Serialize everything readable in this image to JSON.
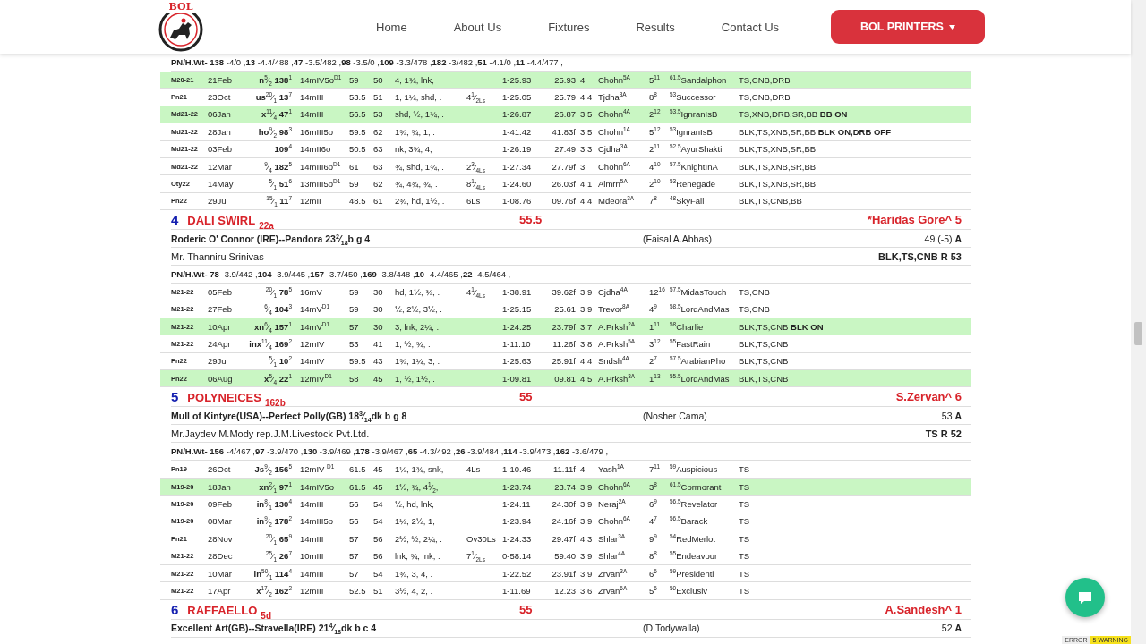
{
  "header": {
    "logo_text": "BOL",
    "nav": [
      "Home",
      "About Us",
      "Fixtures",
      "Results",
      "Contact Us"
    ],
    "button": "BOL PRINTERS"
  },
  "horses": [
    {
      "past_runs": "**PN/H.Wt- 138** -4/0 ,**13** -4.4/488 ,**47** -3.5/482 ,**98** -3.5/0 ,**109** -3.3/478 ,**182** -3/482 ,**51** -4.1/0 ,**11** -4.4/477 ,",
      "rows": [
        {
          "highlighted": true,
          "race": "M20-21",
          "date": "21Feb",
          "odds": "**n**$^{5}$⁄$_{2}$ **138**$^{1}$",
          "distance": "14mIV5o$^{D1}$",
          "weight": "59",
          "rating": "50",
          "margins": "4, 1¾, lnk,",
          "time": "1-25.93",
          "sectional": "25.93",
          "pace": "4",
          "jockey": "Chohn$^{5A}$",
          "placing": "5$^{11}$",
          "winner": "$^{61.5}$Sandalphon",
          "gear": "TS,CNB,DRB"
        },
        {
          "highlighted": false,
          "race": "Pn21",
          "date": "23Oct",
          "odds": "**us**$^{20}$⁄$_{1}$ **13**$^{7}$",
          "distance": "14mIII",
          "weight": "53.5",
          "rating": "51",
          "margins": "1, 1¼, shd, .",
          "beaten": "4$^{1}$⁄$_{2Ls}$",
          "time": "1-25.05",
          "sectional": "25.79",
          "pace": "4.4",
          "jockey": "Tjdha$^{3A}$",
          "placing": "8$^{8}$",
          "winner": "$^{53}$Successor",
          "gear": "TS,CNB,DRB"
        },
        {
          "highlighted": true,
          "race": "Md21-22",
          "date": "06Jan",
          "odds": "**x**$^{11}$⁄$_{4}$ **47**$^{1}$",
          "distance": "14mIII",
          "weight": "56.5",
          "rating": "53",
          "margins": "shd, ½, 1¾, .",
          "time": "1-26.87",
          "sectional": "26.87",
          "pace": "3.5",
          "jockey": "Chohn$^{4A}$",
          "placing": "2$^{12}$",
          "winner": "$^{53.5}$IgnranIsB",
          "gear": "TS,XNB,DRB,SR,BB **BB ON**"
        },
        {
          "highlighted": false,
          "race": "Md21-22",
          "date": "28Jan",
          "odds": "**ho**$^{9}$⁄$_{2}$ **98**$^{3}$",
          "distance": "16mIII5o",
          "weight": "59.5",
          "rating": "62",
          "margins": "1¾, ¾, 1, .",
          "time": "1-41.42",
          "sectional": "41.83f",
          "pace": "3.5",
          "jockey": "Chohn$^{1A}$",
          "placing": "5$^{12}$",
          "winner": "$^{53}$IgnranIsB",
          "gear": "BLK,TS,XNB,SR,BB **BLK ON,DRB OFF**"
        },
        {
          "highlighted": false,
          "race": "Md21-22",
          "date": "03Feb",
          "odds": "**109**$^{4}$",
          "distance": "14mII6o",
          "weight": "50.5",
          "rating": "63",
          "margins": "nk, 3¾, 4,",
          "time": "1-26.19",
          "sectional": "27.49",
          "pace": "3.3",
          "jockey": "Cjdha$^{3A}$",
          "placing": "2$^{11}$",
          "winner": "$^{52.5}$AyurShakti",
          "gear": "BLK,TS,XNB,SR,BB"
        },
        {
          "highlighted": false,
          "race": "Md21-22",
          "date": "12Mar",
          "odds": "$^{9}$⁄$_{4}$ **182**$^{5}$",
          "distance": "14mIII6o$^{D1}$",
          "weight": "61",
          "rating": "63",
          "margins": "¾, shd, 1¾, .",
          "beaten": "2$^{3}$⁄$_{4Ls}$",
          "time": "1-27.34",
          "sectional": "27.79f",
          "pace": "3",
          "jockey": "Chohn$^{6A}$",
          "placing": "4$^{10}$",
          "winner": "$^{57.5}$KnightInA",
          "gear": "BLK,TS,XNB,SR,BB"
        },
        {
          "highlighted": false,
          "race": "Oty22",
          "date": "14May",
          "odds": "$^{5}$⁄$_{1}$ **51**$^{6}$",
          "distance": "13mIII5o$^{D1}$",
          "weight": "59",
          "rating": "62",
          "margins": "¾, 4¾, ¾, .",
          "beaten": "8$^{1}$⁄$_{4Ls}$",
          "time": "1-24.60",
          "sectional": "26.03f",
          "pace": "4.1",
          "jockey": "Almrn$^{5A}$",
          "placing": "2$^{10}$",
          "winner": "$^{53}$Renegade",
          "gear": "BLK,TS,XNB,SR,BB"
        },
        {
          "highlighted": false,
          "race": "Pn22",
          "date": "29Jul",
          "odds": "$^{15}$⁄$_{1}$ **11**$^{7}$",
          "distance": "12mII",
          "weight": "48.5",
          "rating": "61",
          "margins": "2¾, hd, 1½, .",
          "beaten": "6Ls",
          "time": "1-08.76",
          "sectional": "09.76f",
          "pace": "4.4",
          "jockey": "Mdeora$^{3A}$",
          "placing": "7$^{8}$",
          "winner": "$^{48}$SkyFall",
          "gear": "BLK,TS,CNB,BB"
        }
      ]
    },
    {
      "number": "4",
      "name": "DALI SWIRL",
      "tag": "22a",
      "carried_weight": "55.5",
      "jockey": "*Haridas Gore^ 5",
      "pedigree": "Roderic O' Connor (IRE)--Pandora 23$^{2}$⁄$_{18}$b g 4",
      "trainer": "(Faisal A.Abbas)",
      "rating": "49 (-5) **A**",
      "owner": "Mr. Thanniru Srinivas",
      "gear": "BLK,TS,CNB R 53",
      "past_runs": "**PN/H.Wt- 78** -3.9/442 ,**104** -3.9/445 ,**157** -3.7/450 ,**169** -3.8/448 ,**10** -4.4/465 ,**22** -4.5/464 ,",
      "rows": [
        {
          "highlighted": false,
          "race": "M21-22",
          "date": "05Feb",
          "odds": "$^{20}$⁄$_{1}$ **78**$^{5}$",
          "distance": "16mV",
          "weight": "59",
          "rating": "30",
          "margins": "hd, 1½, ¾, .",
          "beaten": "4$^{1}$⁄$_{4Ls}$",
          "time": "1-38.91",
          "sectional": "39.62f",
          "pace": "3.9",
          "jockey": "Cjdha$^{4A}$",
          "placing": "12$^{16}$",
          "winner": "$^{57.5}$MidasTouch",
          "gear": "TS,CNB"
        },
        {
          "highlighted": false,
          "race": "M21-22",
          "date": "27Feb",
          "odds": "$^{6}$⁄$_{4}$ **104**$^{3}$",
          "distance": "14mV$^{D1}$",
          "weight": "59",
          "rating": "30",
          "margins": "½, 2½, 3½, .",
          "time": "1-25.15",
          "sectional": "25.61",
          "pace": "3.9",
          "jockey": "Trevor$^{8A}$",
          "placing": "4$^{9}$",
          "winner": "$^{58.5}$LordAndMas",
          "gear": "TS,CNB"
        },
        {
          "highlighted": true,
          "race": "M21-22",
          "date": "10Apr",
          "odds": "**xn**$^{6}$⁄$_{4}$ **157**$^{1}$",
          "distance": "14mV$^{D1}$",
          "weight": "57",
          "rating": "30",
          "margins": "3, lnk, 2¼, .",
          "time": "1-24.25",
          "sectional": "23.79f",
          "pace": "3.7",
          "jockey": "A.Prksh$^{2A}$",
          "placing": "1$^{11}$",
          "winner": "$^{58}$Charlie",
          "gear": "BLK,TS,CNB **BLK ON**"
        },
        {
          "highlighted": false,
          "race": "M21-22",
          "date": "24Apr",
          "odds": "**inx**$^{11}$⁄$_{4}$ **169**$^{2}$",
          "distance": "12mIV",
          "weight": "53",
          "rating": "41",
          "margins": "1, ½, ¾, .",
          "time": "1-11.10",
          "sectional": "11.26f",
          "pace": "3.8",
          "jockey": "A.Prksh$^{5A}$",
          "placing": "3$^{12}$",
          "winner": "$^{55}$FastRain",
          "gear": "BLK,TS,CNB"
        },
        {
          "highlighted": false,
          "race": "Pn22",
          "date": "29Jul",
          "odds": "$^{5}$⁄$_{1}$ **10**$^{2}$",
          "distance": "14mIV",
          "weight": "59.5",
          "rating": "43",
          "margins": "1¾, 1¼, 3, .",
          "time": "1-25.63",
          "sectional": "25.91f",
          "pace": "4.4",
          "jockey": "Sndsh$^{4A}$",
          "placing": "2$^{7}$",
          "winner": "$^{57.5}$ArabianPho",
          "gear": "BLK,TS,CNB"
        },
        {
          "highlighted": true,
          "race": "Pn22",
          "date": "06Aug",
          "odds": "**x**$^{5}$⁄$_{4}$ **22**$^{1}$",
          "distance": "12mIV$^{D1}$",
          "weight": "58",
          "rating": "45",
          "margins": "1, ½, 1½, .",
          "time": "1-09.81",
          "sectional": "09.81",
          "pace": "4.5",
          "jockey": "A.Prksh$^{3A}$",
          "placing": "1$^{13}$",
          "winner": "$^{55.5}$LordAndMas",
          "gear": "BLK,TS,CNB"
        }
      ]
    },
    {
      "number": "5",
      "name": "POLYNEICES",
      "tag": "162b",
      "carried_weight": "55",
      "jockey": "S.Zervan^ 6",
      "pedigree": "Mull of Kintyre(USA)--Perfect Polly(GB) 18$^{3}$⁄$_{14}$dk b g 8",
      "trainer": "(Nosher Cama)",
      "rating": "53 **A**",
      "owner": "Mr.Jaydev M.Mody rep.J.M.Livestock Pvt.Ltd.",
      "gear": "TS R 52",
      "past_runs": "**PN/H.Wt- 156** -4/467 ,**97** -3.9/470 ,**130** -3.9/469 ,**178** -3.9/467 ,**65** -4.3/492 ,**26** -3.9/484 ,**114** -3.9/473 ,**162** -3.6/479 ,",
      "rows": [
        {
          "highlighted": false,
          "race": "Pn19",
          "date": "26Oct",
          "odds": "**Js**$^{9}$⁄$_{2}$ **156**$^{5}$",
          "distance": "12mIV-$^{D1}$",
          "weight": "61.5",
          "rating": "45",
          "margins": "1¼, 1¾, snk,",
          "beaten": "4Ls",
          "time": "1-10.46",
          "sectional": "11.11f",
          "pace": "4",
          "jockey": "Yash$^{1A}$",
          "placing": "7$^{11}$",
          "winner": "$^{59}$Auspicious",
          "gear": "TS"
        },
        {
          "highlighted": true,
          "race": "M19-20",
          "date": "18Jan",
          "odds": "**xn**$^{2}$⁄$_{1}$ **97**$^{1}$",
          "distance": "14mIV5o",
          "weight": "61.5",
          "rating": "45",
          "margins": "1½, ¾, 4$^{1}$⁄$_{2}$,",
          "time": "1-23.74",
          "sectional": "23.74",
          "pace": "3.9",
          "jockey": "Chohn$^{6A}$",
          "placing": "3$^{8}$",
          "winner": "$^{61.5}$Cormorant",
          "gear": "TS"
        },
        {
          "highlighted": false,
          "race": "M19-20",
          "date": "09Feb",
          "odds": "**in**$^{8}$⁄$_{1}$ **130**$^{4}$",
          "distance": "14mIII",
          "weight": "56",
          "rating": "54",
          "margins": "½, hd, lnk,",
          "time": "1-24.11",
          "sectional": "24.30f",
          "pace": "3.9",
          "jockey": "Neraj$^{2A}$",
          "placing": "6$^{9}$",
          "winner": "$^{56.5}$Revelator",
          "gear": "TS"
        },
        {
          "highlighted": false,
          "race": "M19-20",
          "date": "08Mar",
          "odds": "**in**$^{9}$⁄$_{2}$ **178**$^{2}$",
          "distance": "14mIII5o",
          "weight": "56",
          "rating": "54",
          "margins": "1¼, 2½, 1,",
          "time": "1-23.94",
          "sectional": "24.16f",
          "pace": "3.9",
          "jockey": "Chohn$^{6A}$",
          "placing": "4$^{7}$",
          "winner": "$^{56.5}$Barack",
          "gear": "TS"
        },
        {
          "highlighted": false,
          "race": "Pn21",
          "date": "28Nov",
          "odds": "$^{20}$⁄$_{1}$ **65**$^{9}$",
          "distance": "14mIII",
          "weight": "57",
          "rating": "56",
          "margins": "2½, ½, 2¼, .",
          "beaten": "Ov30Ls",
          "time": "1-24.33",
          "sectional": "29.47f",
          "pace": "4.3",
          "jockey": "Shlar$^{3A}$",
          "placing": "9$^{9}$",
          "winner": "$^{54}$RedMerlot",
          "gear": "TS"
        },
        {
          "highlighted": false,
          "race": "M21-22",
          "date": "28Dec",
          "odds": "$^{25}$⁄$_{1}$ **26**$^{7}$",
          "distance": "10mIII",
          "weight": "57",
          "rating": "56",
          "margins": "lnk, ¾, lnk, .",
          "beaten": "7$^{1}$⁄$_{2Ls}$",
          "time": "0-58.14",
          "sectional": "59.40",
          "pace": "3.9",
          "jockey": "Shlar$^{4A}$",
          "placing": "8$^{8}$",
          "winner": "$^{55}$Endeavour",
          "gear": "TS"
        },
        {
          "highlighted": false,
          "race": "M21-22",
          "date": "10Mar",
          "odds": "**in**$^{50}$⁄$_{1}$ **114**$^{4}$",
          "distance": "14mIII",
          "weight": "57",
          "rating": "54",
          "margins": "1¾, 3, 4, .",
          "time": "1-22.52",
          "sectional": "23.91f",
          "pace": "3.9",
          "jockey": "Zrvan$^{3A}$",
          "placing": "6$^{6}$",
          "winner": "$^{59}$Presidenti",
          "gear": "TS"
        },
        {
          "highlighted": false,
          "race": "M21-22",
          "date": "17Apr",
          "odds": "**x**$^{17}$⁄$_{2}$ **162**$^{2}$",
          "distance": "12mIII",
          "weight": "52.5",
          "rating": "51",
          "margins": "3½, 4, 2, .",
          "time": "1-11.69",
          "sectional": "12.23",
          "pace": "3.6",
          "jockey": "Zrvan$^{6A}$",
          "placing": "5$^{6}$",
          "winner": "$^{50}$Exclusiv",
          "gear": "TS"
        }
      ]
    },
    {
      "number": "6",
      "name": "RAFFAELLO",
      "tag": "5d",
      "carried_weight": "55",
      "jockey": "A.Sandesh^ 1",
      "pedigree": "Excellent Art(GB)--Stravella(IRE) 21$^{4}$⁄$_{18}$dk b c 4",
      "trainer": "(D.Todywalla)",
      "rating": "52 **A**"
    }
  ],
  "debug_bar": [
    "ERROR",
    "5 WARNING"
  ]
}
